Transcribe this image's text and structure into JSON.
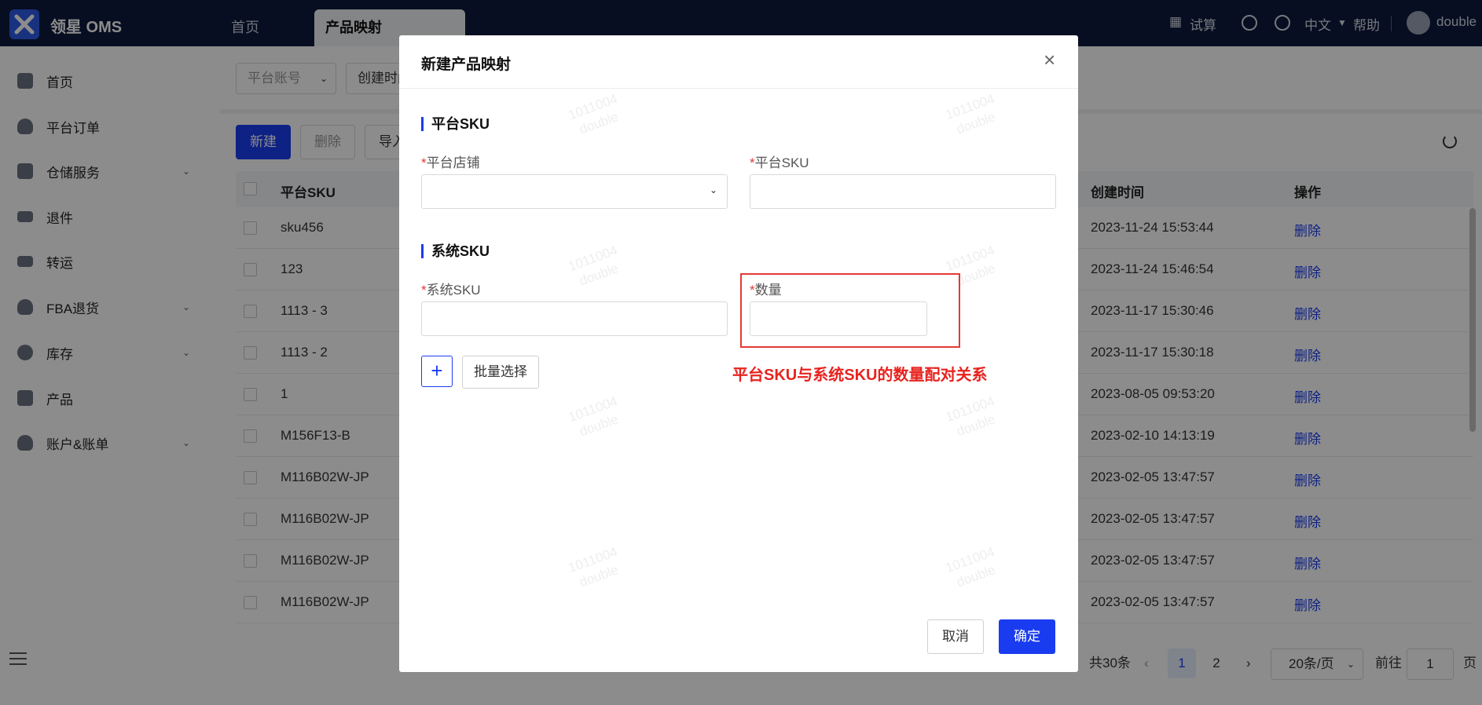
{
  "app": {
    "brand": "领星 OMS"
  },
  "tabs": [
    {
      "label": "首页"
    },
    {
      "label": "产品映射"
    }
  ],
  "top_right": {
    "calc": "试算",
    "lang": "中文",
    "help": "帮助",
    "user": "double"
  },
  "sidebar": {
    "items": [
      {
        "label": "首页",
        "icon": "home-icon"
      },
      {
        "label": "平台订单",
        "icon": "shield-icon"
      },
      {
        "label": "仓储服务",
        "icon": "warehouse-icon",
        "expandable": true
      },
      {
        "label": "退件",
        "icon": "truck-icon"
      },
      {
        "label": "转运",
        "icon": "truck-icon"
      },
      {
        "label": "FBA退货",
        "icon": "shield-icon",
        "expandable": true
      },
      {
        "label": "库存",
        "icon": "pie-icon",
        "expandable": true
      },
      {
        "label": "产品",
        "icon": "bag-icon"
      },
      {
        "label": "账户&账单",
        "icon": "shield-icon",
        "expandable": true
      }
    ]
  },
  "filters": {
    "platform_account": "平台账号",
    "create_time": "创建时间"
  },
  "toolbar": {
    "new": "新建",
    "delete": "删除",
    "import": "导入"
  },
  "table": {
    "headers": {
      "sku": "平台SKU",
      "created": "创建时间",
      "action": "操作"
    },
    "rows": [
      {
        "sku": "sku456",
        "created": "2023-11-24 15:53:44",
        "action": "删除"
      },
      {
        "sku": "123",
        "created": "2023-11-24 15:46:54",
        "action": "删除"
      },
      {
        "sku": "1113 - 3",
        "created": "2023-11-17 15:30:46",
        "action": "删除"
      },
      {
        "sku": "1113 - 2",
        "created": "2023-11-17 15:30:18",
        "action": "删除"
      },
      {
        "sku": "1",
        "created": "2023-08-05 09:53:20",
        "action": "删除"
      },
      {
        "sku": "M156F13-B",
        "created": "2023-02-10 14:13:19",
        "action": "删除"
      },
      {
        "sku": "M116B02W-JP",
        "created": "2023-02-05 13:47:57",
        "action": "删除"
      },
      {
        "sku": "M116B02W-JP",
        "created": "2023-02-05 13:47:57",
        "action": "删除"
      },
      {
        "sku": "M116B02W-JP",
        "created": "2023-02-05 13:47:57",
        "action": "删除"
      },
      {
        "sku": "M116B02W-JP",
        "created": "2023-02-05 13:47:57",
        "action": "删除"
      }
    ]
  },
  "pager": {
    "total": "共30条",
    "page1": "1",
    "page2": "2",
    "page_size": "20条/页",
    "goto_label": "前往",
    "goto_value": "1",
    "page_unit": "页"
  },
  "modal": {
    "title": "新建产品映射",
    "close": "×",
    "section1": "平台SKU",
    "store_label": "平台店铺",
    "platform_sku_label": "平台SKU",
    "section2": "系统SKU",
    "system_sku_label": "系统SKU",
    "qty_label": "数量",
    "required_mark": "*",
    "plus": "+",
    "batch_select": "批量选择",
    "annotation": "平台SKU与系统SKU的数量配对关系",
    "cancel": "取消",
    "confirm": "确定"
  },
  "watermark": {
    "line1": "1011004",
    "line2": "double"
  },
  "colors": {
    "primary": "#1a3cf0",
    "topbar": "#0e1a3c",
    "annotation": "#e8231f"
  }
}
